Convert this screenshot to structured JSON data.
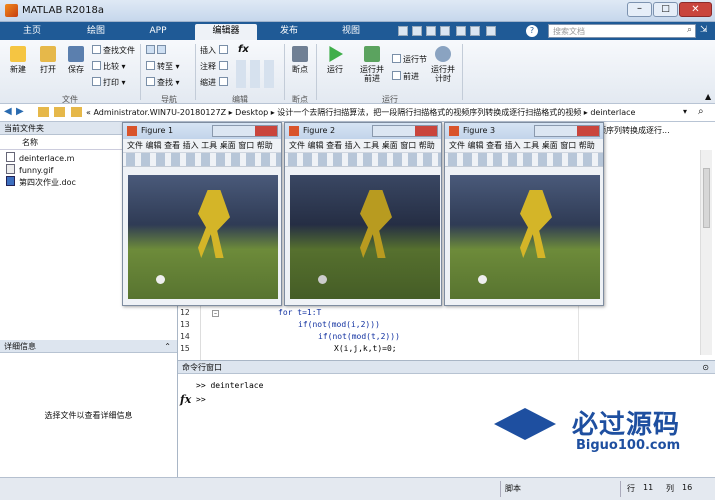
{
  "window": {
    "title": "MATLAB R2018a"
  },
  "tabs": [
    {
      "label": "主页"
    },
    {
      "label": "绘图"
    },
    {
      "label": "APP"
    },
    {
      "label": "编辑器"
    },
    {
      "label": "发布"
    },
    {
      "label": "视图"
    }
  ],
  "search": {
    "placeholder": "搜索文档"
  },
  "ribbon": {
    "new": "新建",
    "open": "打开",
    "save": "保存",
    "find_files": "查找文件",
    "compare": "比较",
    "print": "打印",
    "goto": "转至",
    "find": "查找",
    "insert": "插入",
    "comment": "注释",
    "indent": "缩进",
    "breakpoints": "断点",
    "run": "运行",
    "run_advance": "运行并\n前进",
    "run_section": "运行节",
    "advance": "前进",
    "run_time": "运行并\n计时",
    "groups": {
      "file": "文件",
      "nav": "导航",
      "edit": "编辑",
      "bp": "断点",
      "run": "运行"
    }
  },
  "address": {
    "path": "« Administrator.WIN7U-20180127Z  ▸  Desktop  ▸  设计一个去隔行扫描算法，把一段隔行扫描格式的视频序列转换成逐行扫描格式的视频  ▸  deinterlace"
  },
  "current_folder": {
    "title": "当前文件夹",
    "col_name": "名称",
    "files": [
      {
        "name": "deinterlace.m"
      },
      {
        "name": "funny.gif"
      },
      {
        "name": "第四次作业.doc"
      }
    ]
  },
  "details": {
    "title": "详细信息",
    "message": "选择文件以查看详细信息"
  },
  "editor": {
    "tab_tail": "频序列转换成逐行...",
    "lines": [
      {
        "n": "12",
        "code": "for t=1:T"
      },
      {
        "n": "13",
        "code": "if(not(mod(i,2)))"
      },
      {
        "n": "14",
        "code": "if(not(mod(t,2)))"
      },
      {
        "n": "15",
        "code": "X(i,j,k,t)=0;"
      }
    ]
  },
  "command_window": {
    "title": "命令行窗口",
    "history": ">> deinterlace",
    "prompt": ">>",
    "fx": "fx"
  },
  "figures": [
    {
      "title": "Figure 1"
    },
    {
      "title": "Figure 2"
    },
    {
      "title": "Figure 3"
    }
  ],
  "figure_menu": {
    "items": "文件  编辑  查看  插入  工具  桌面  窗口  帮助"
  },
  "watermark": {
    "brand": "必过源码",
    "url": "Biguo100.com"
  },
  "status": {
    "script": "脚本",
    "row_label": "行",
    "row": "11",
    "col_label": "列",
    "col": "16"
  },
  "colors": {
    "tabbar": "#1f5a96",
    "accent": "#2a6bb0"
  }
}
